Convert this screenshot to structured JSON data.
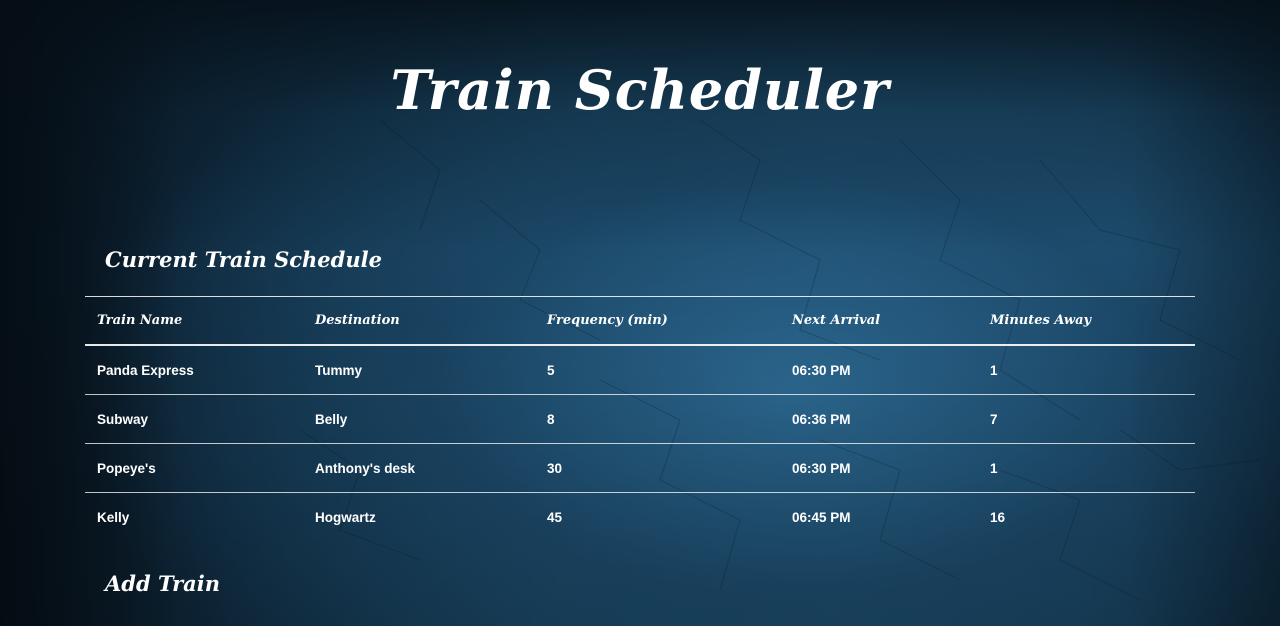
{
  "header": {
    "title": "Train Scheduler"
  },
  "schedule": {
    "title": "Current Train Schedule",
    "columns": [
      "Train Name",
      "Destination",
      "Frequency (min)",
      "Next Arrival",
      "Minutes Away"
    ],
    "rows": [
      [
        "Panda Express",
        "Tummy",
        "5",
        "06:30 PM",
        "1"
      ],
      [
        "Subway",
        "Belly",
        "8",
        "06:36 PM",
        "7"
      ],
      [
        "Popeye's",
        "Anthony's desk",
        "30",
        "06:30 PM",
        "1"
      ],
      [
        "Kelly",
        "Hogwartz",
        "45",
        "06:45 PM",
        "16"
      ]
    ]
  },
  "add_train": {
    "title": "Add Train"
  },
  "colors": {
    "background_dark": "#0b1c2a",
    "background_mid": "#1b4d6b",
    "text": "#ffffff"
  }
}
